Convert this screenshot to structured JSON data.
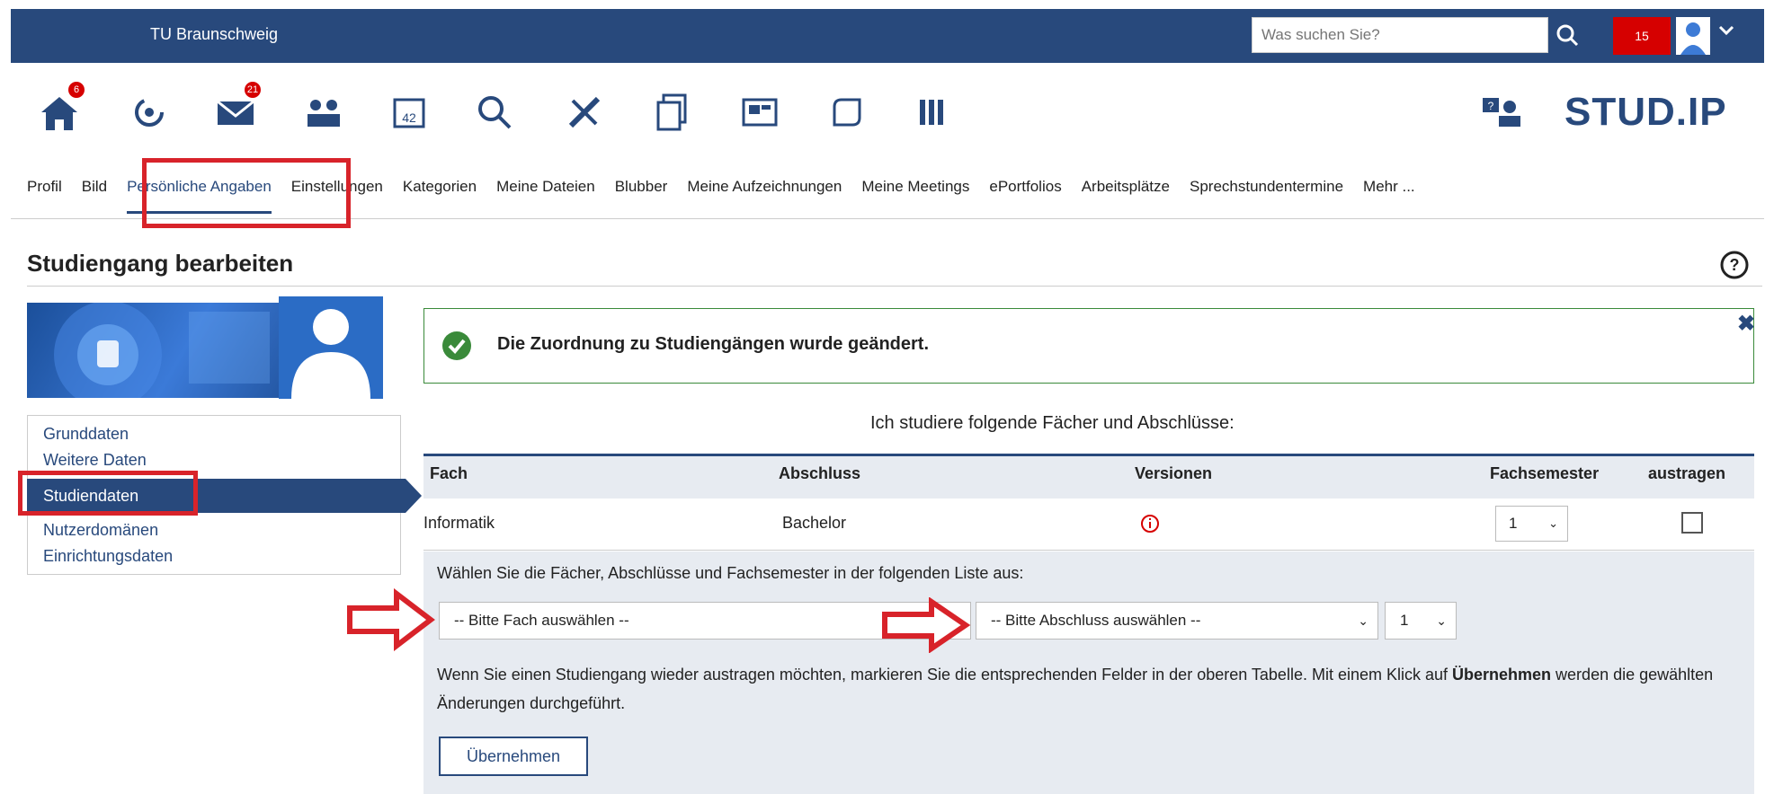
{
  "header": {
    "brand": "TU Braunschweig",
    "search_placeholder": "Was suchen Sie?",
    "notification_count": "15"
  },
  "nav": {
    "badges": {
      "home": "6",
      "messages": "21"
    }
  },
  "logo": "STUD.IP",
  "tabs": [
    {
      "label": "Profil"
    },
    {
      "label": "Bild"
    },
    {
      "label": "Persönliche Angaben"
    },
    {
      "label": "Einstellungen"
    },
    {
      "label": "Kategorien"
    },
    {
      "label": "Meine Dateien"
    },
    {
      "label": "Blubber"
    },
    {
      "label": "Meine Aufzeichnungen"
    },
    {
      "label": "Meine Meetings"
    },
    {
      "label": "ePortfolios"
    },
    {
      "label": "Arbeitsplätze"
    },
    {
      "label": "Sprechstundentermine"
    },
    {
      "label": "Mehr ..."
    }
  ],
  "page_title": "Studiengang bearbeiten",
  "sidebar": {
    "items": [
      "Grunddaten",
      "Weitere Daten",
      "Studiendaten",
      "Nutzerdomänen",
      "Einrichtungsdaten"
    ],
    "active": "Studiendaten"
  },
  "message": {
    "text": "Die Zuordnung zu Studiengängen wurde geändert."
  },
  "table": {
    "caption": "Ich studiere folgende Fächer und Abschlüsse:",
    "headers": [
      "Fach",
      "Abschluss",
      "Versionen",
      "Fachsemester",
      "austragen"
    ],
    "rows": [
      {
        "fach": "Informatik",
        "abschluss": "Bachelor",
        "semester": "1"
      }
    ]
  },
  "form": {
    "prompt": "Wählen Sie die Fächer, Abschlüsse und Fachsemester in der folgenden Liste aus:",
    "fach_select": "-- Bitte Fach auswählen --",
    "abschluss_select": "-- Bitte Abschluss auswählen --",
    "semester_select": "1",
    "info_part1": "Wenn Sie einen Studiengang wieder austragen möchten, markieren Sie die entsprechenden Felder in der oberen Tabelle. Mit einem Klick auf ",
    "info_bold": "Übernehmen",
    "info_part2": " werden die gewählten Änderungen durchgeführt.",
    "apply_label": "Übernehmen"
  },
  "colors": {
    "brand_blue": "#28497c",
    "highlight_red": "#d8232a",
    "success_green": "#3a8a3a"
  }
}
